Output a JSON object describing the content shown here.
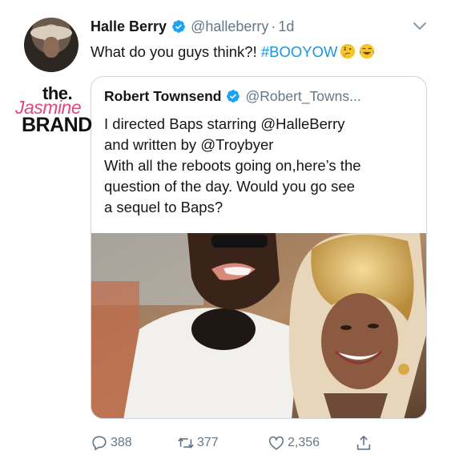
{
  "tweet": {
    "author_name": "Halle Berry",
    "author_handle": "@halleberry",
    "separator": "·",
    "time": "1d",
    "text_main": "What do you guys think?! ",
    "hashtag": "#BOOYOW",
    "emojis": [
      "thinking-face-emoji",
      "tears-of-joy-emoji"
    ]
  },
  "quote": {
    "author_name": "Robert Townsend",
    "author_handle": "@Robert_Towns...",
    "lines": [
      "I directed Baps starring @HalleBerry",
      "and written by @Troybyer",
      "With all the reboots going on,here’s the",
      "question of the day. Would you go see",
      "a sequel to Baps?"
    ]
  },
  "watermark": {
    "the": "the.",
    "jasmine": "Jasmine",
    "brand": "BRAND"
  },
  "actions": {
    "replies": "388",
    "retweets": "377",
    "likes": "2,356"
  },
  "colors": {
    "link": "#1b95e0",
    "verified": "#1da1f2",
    "muted": "#657786",
    "border": "#ccd6dd",
    "watermark_pink": "#e0477a"
  }
}
